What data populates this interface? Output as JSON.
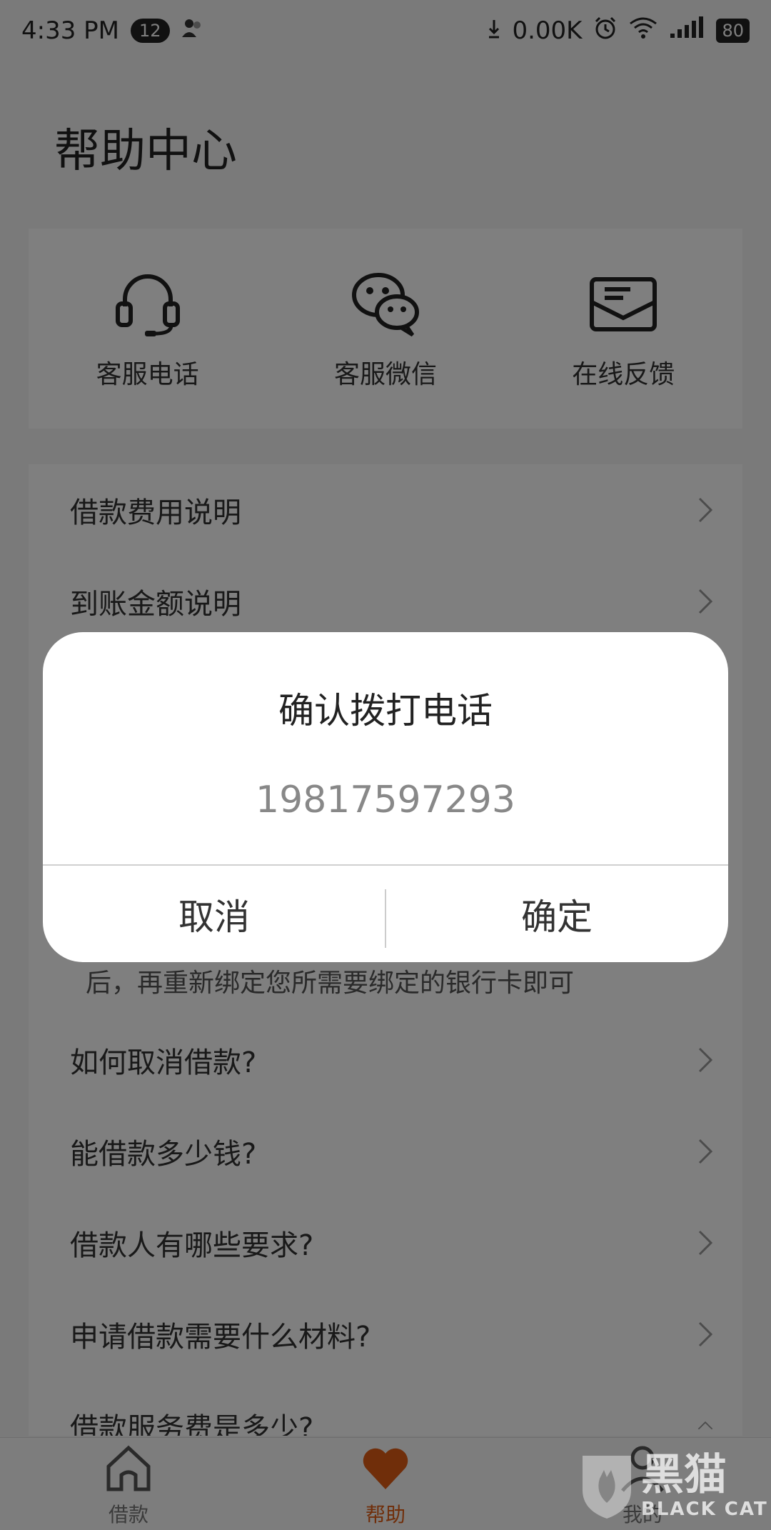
{
  "status_bar": {
    "time": "4:33 PM",
    "notification_count": "12",
    "net_speed": "0.00K",
    "battery": "80"
  },
  "page": {
    "title": "帮助中心"
  },
  "contact": {
    "items": [
      {
        "label": "客服电话",
        "icon": "headset-icon"
      },
      {
        "label": "客服微信",
        "icon": "wechat-icon"
      },
      {
        "label": "在线反馈",
        "icon": "mail-icon"
      }
    ]
  },
  "faq": {
    "items": [
      {
        "label": "借款费用说明"
      },
      {
        "label": "到账金额说明"
      },
      {
        "label": "如何取消借款?"
      },
      {
        "label": "能借款多少钱?"
      },
      {
        "label": "借款人有哪些要求?"
      },
      {
        "label": "申请借款需要什么材料?"
      },
      {
        "label": "借款服务费是多少?"
      }
    ],
    "answer_fragment": "后，再重新绑定您所需要绑定的银行卡即可"
  },
  "dialog": {
    "title": "确认拨打电话",
    "message": "19817597293",
    "cancel_label": "取消",
    "confirm_label": "确定"
  },
  "tab_bar": {
    "tabs": [
      {
        "label": "借款",
        "icon": "home-icon"
      },
      {
        "label": "帮助",
        "icon": "heart-icon",
        "active": true
      },
      {
        "label": "我的",
        "icon": "user-icon"
      }
    ]
  },
  "watermark": {
    "cn": "黑猫",
    "en": "BLACK CAT"
  },
  "colors": {
    "accent": "#e05d14",
    "overlay": "rgba(0,0,0,0.5)"
  }
}
